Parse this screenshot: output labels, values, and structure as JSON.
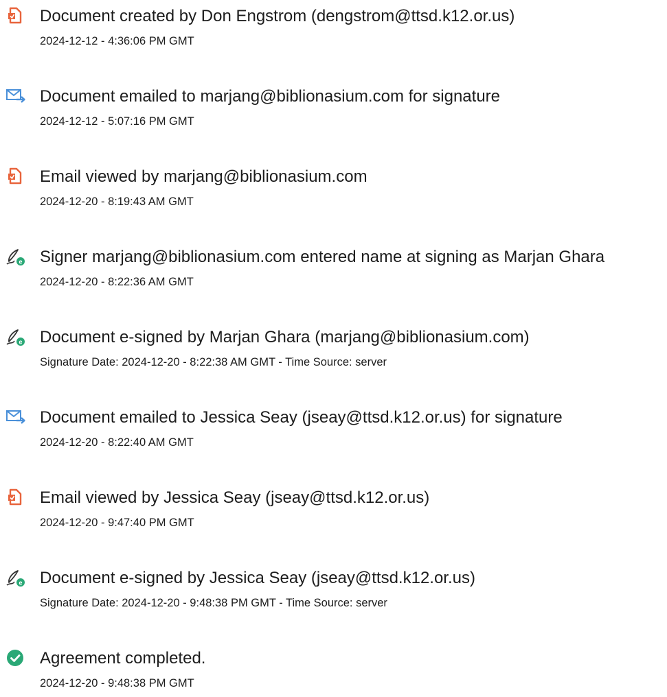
{
  "colors": {
    "document_icon": "#e8643c",
    "email_icon": "#4a90d9",
    "sign_icon": "#2aa876",
    "complete_icon": "#2aa876",
    "text": "#1d1d1d"
  },
  "events": [
    {
      "icon": "document-icon",
      "title": "Document created by Don Engstrom (dengstrom@ttsd.k12.or.us)",
      "detail": "2024-12-12 - 4:36:06 PM GMT"
    },
    {
      "icon": "email-icon",
      "title": "Document emailed to marjang@biblionasium.com for signature",
      "detail": "2024-12-12 - 5:07:16 PM GMT"
    },
    {
      "icon": "document-icon",
      "title": "Email viewed by marjang@biblionasium.com",
      "detail": "2024-12-20 - 8:19:43 AM GMT"
    },
    {
      "icon": "e-sign-icon",
      "title": "Signer marjang@biblionasium.com entered name at signing as Marjan Ghara",
      "detail": "2024-12-20 - 8:22:36 AM GMT"
    },
    {
      "icon": "e-sign-icon",
      "title": "Document e-signed by Marjan Ghara (marjang@biblionasium.com)",
      "detail": "Signature Date: 2024-12-20 - 8:22:38 AM GMT - Time Source: server"
    },
    {
      "icon": "email-icon",
      "title": "Document emailed to Jessica Seay (jseay@ttsd.k12.or.us) for signature",
      "detail": "2024-12-20 - 8:22:40 AM GMT"
    },
    {
      "icon": "document-icon",
      "title": "Email viewed by Jessica Seay (jseay@ttsd.k12.or.us)",
      "detail": "2024-12-20 - 9:47:40 PM GMT"
    },
    {
      "icon": "e-sign-icon",
      "title": "Document e-signed by Jessica Seay (jseay@ttsd.k12.or.us)",
      "detail": "Signature Date: 2024-12-20 - 9:48:38 PM GMT - Time Source: server"
    },
    {
      "icon": "check-circle-icon",
      "title": "Agreement completed.",
      "detail": "2024-12-20 - 9:48:38 PM GMT"
    }
  ]
}
